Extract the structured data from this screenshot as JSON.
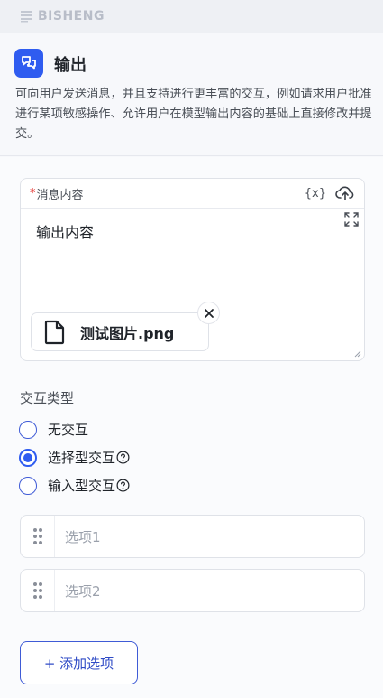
{
  "app": {
    "brand": "BISHENG"
  },
  "node": {
    "title": "输出",
    "description": "可向用户发送消息，并且支持进行更丰富的交互，例如请求用户批准进行某项敏感操作、允许用户在模型输出内容的基础上直接修改并提交。"
  },
  "message": {
    "required_mark": "*",
    "label": "消息内容",
    "variable_button": "{x}",
    "text": "输出内容",
    "attachment": {
      "file_name": "测试图片.png"
    }
  },
  "interaction": {
    "label": "交互类型",
    "options": [
      {
        "label": "无交互",
        "selected": false,
        "has_help": false
      },
      {
        "label": "选择型交互",
        "selected": true,
        "has_help": true
      },
      {
        "label": "输入型交互",
        "selected": false,
        "has_help": true
      }
    ]
  },
  "choice_options": [
    {
      "placeholder": "选项1"
    },
    {
      "placeholder": "选项2"
    }
  ],
  "add_option_button": "+ 添加选项",
  "colors": {
    "accent": "#2f5cf0",
    "required": "#e53935"
  }
}
